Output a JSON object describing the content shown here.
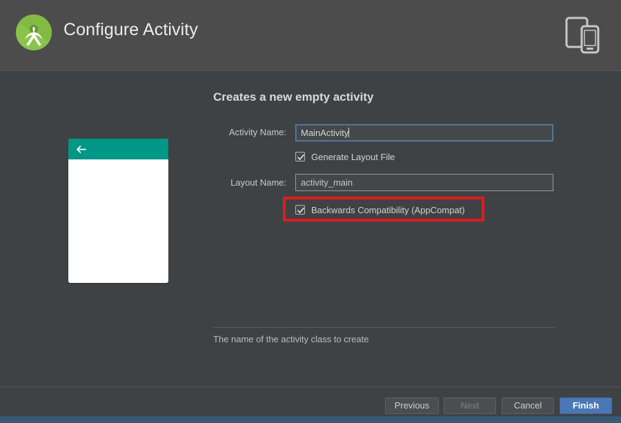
{
  "header": {
    "title": "Configure Activity",
    "logo_icon": "android-studio-logo-icon",
    "device_icon": "tablet-and-phone-icon",
    "logo_green": "#8bc34a",
    "logo_dark_green": "#5f8c2f"
  },
  "main": {
    "heading": "Creates a new empty activity",
    "preview": {
      "appbar_color": "#009688",
      "back_icon": "back-arrow-icon",
      "body_color": "#ffffff"
    },
    "fields": [
      {
        "label": "Activity Name:",
        "value": "MainActivity",
        "focused": true,
        "border_color": "#5c7da6"
      },
      {
        "label": "Layout Name:",
        "value": "activity_main",
        "focused": false,
        "border_color": "#9a9a9a"
      }
    ],
    "checkboxes": [
      {
        "label": "Generate Layout File",
        "checked": true
      },
      {
        "label": "Backwards Compatibility (AppCompat)",
        "checked": true
      }
    ],
    "annotation": {
      "target": "Backwards Compatibility (AppCompat)",
      "color": "#e21b1b"
    },
    "hint": "The name of the activity class to create"
  },
  "footer": {
    "buttons": [
      {
        "label": "Previous",
        "state": "enabled"
      },
      {
        "label": "Next",
        "state": "disabled"
      },
      {
        "label": "Cancel",
        "state": "enabled"
      },
      {
        "label": "Finish",
        "state": "primary"
      }
    ],
    "primary_color": "#4a77b5"
  }
}
